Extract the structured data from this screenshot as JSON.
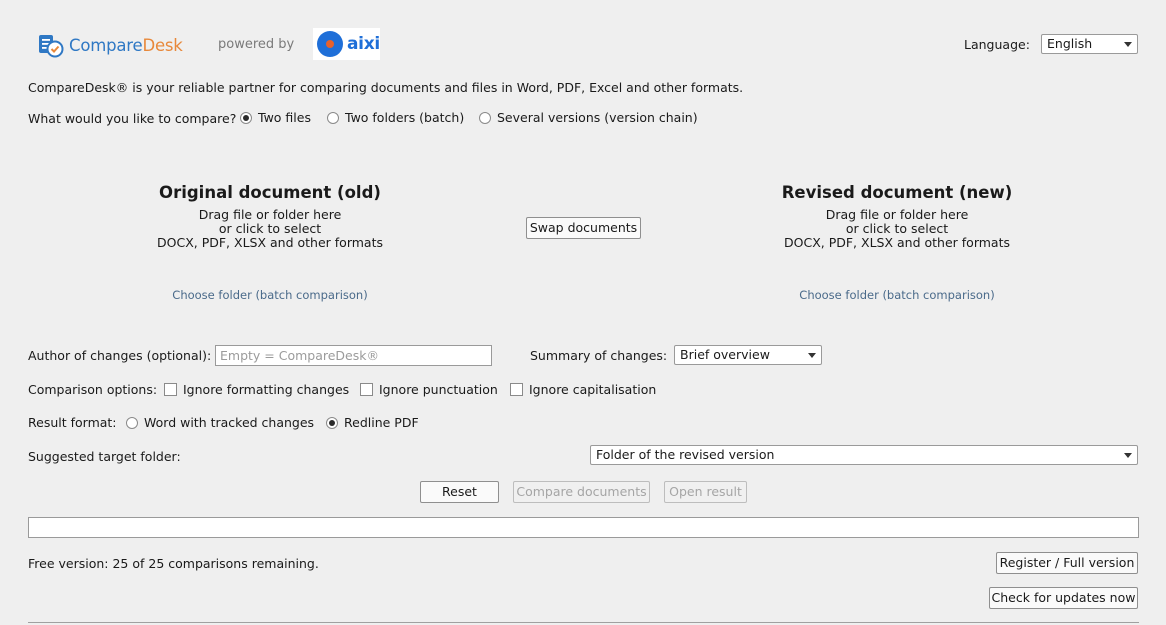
{
  "header": {
    "brand_compare": "Compare",
    "brand_desk": "Desk",
    "powered_by": "powered by",
    "partner_logo_text": "aixi",
    "language_label": "Language:",
    "language_value": "English"
  },
  "intro_text": "CompareDesk® is your reliable partner for comparing documents and files in Word, PDF, Excel and other formats.",
  "compare_mode": {
    "question": "What would you like to compare?",
    "options": [
      {
        "label": "Two files",
        "selected": true
      },
      {
        "label": "Two folders (batch)",
        "selected": false
      },
      {
        "label": "Several versions (version chain)",
        "selected": false
      }
    ]
  },
  "original": {
    "title": "Original document (old)",
    "line1": "Drag file or folder here",
    "line2": "or click to select",
    "line3": "DOCX, PDF, XLSX and other formats",
    "choose_folder": "Choose folder (batch comparison)"
  },
  "revised": {
    "title": "Revised document (new)",
    "line1": "Drag file or folder here",
    "line2": "or click to select",
    "line3": "DOCX, PDF, XLSX and other formats",
    "choose_folder": "Choose folder (batch comparison)"
  },
  "swap_button": "Swap documents",
  "author": {
    "label": "Author of changes (optional):",
    "placeholder": "Empty = CompareDesk®"
  },
  "summary": {
    "label": "Summary of changes:",
    "value": "Brief overview"
  },
  "comparison_options": {
    "label": "Comparison options:",
    "items": [
      {
        "label": "Ignore formatting changes",
        "checked": false
      },
      {
        "label": "Ignore punctuation",
        "checked": false
      },
      {
        "label": "Ignore capitalisation",
        "checked": false
      }
    ]
  },
  "result_format": {
    "label": "Result format:",
    "options": [
      {
        "label": "Word with tracked changes",
        "selected": false
      },
      {
        "label": "Redline PDF",
        "selected": true
      }
    ]
  },
  "target_folder": {
    "label": "Suggested target folder:",
    "value": "Folder of the revised version"
  },
  "actions": {
    "reset": "Reset",
    "compare": "Compare documents",
    "open_result": "Open result"
  },
  "progress": 0,
  "footer": {
    "free_version": "Free version: 25 of 25 comparisons remaining.",
    "register": "Register / Full version",
    "check_updates": "Check for updates now"
  }
}
